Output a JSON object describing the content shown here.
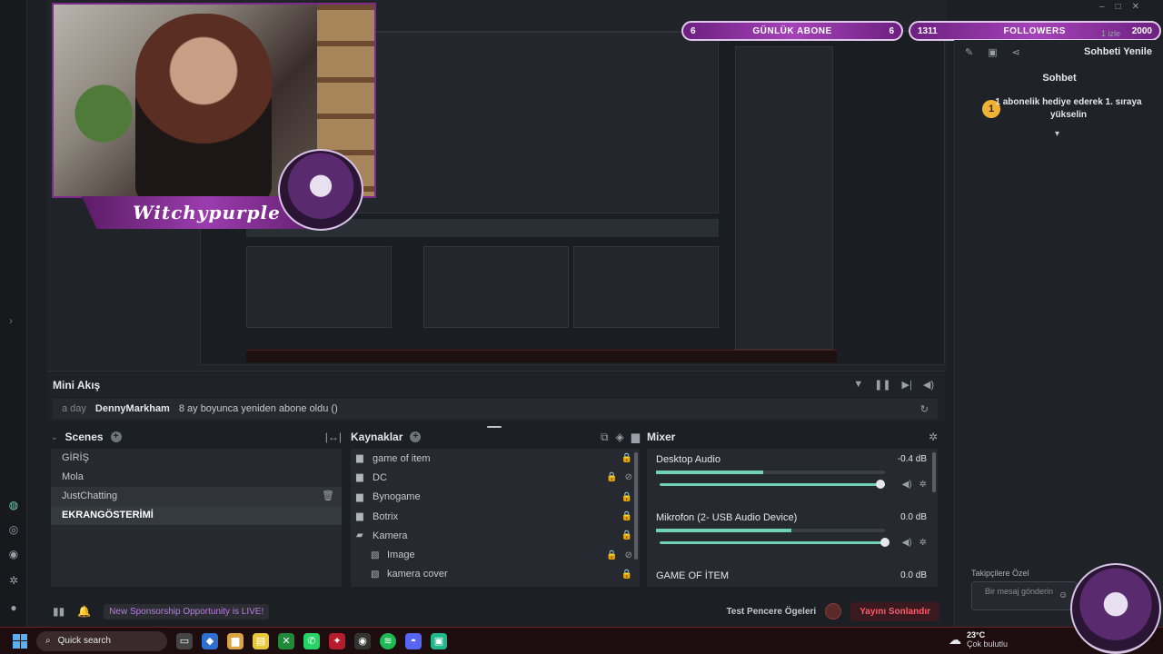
{
  "overlay": {
    "streamer_name": "Witchypurple",
    "daily_subs": {
      "label": "GÜNLÜK ABONE",
      "current": "6",
      "goal": "6"
    },
    "followers": {
      "label": "FOLLOWERS",
      "current": "1311",
      "goal": "2000"
    },
    "viewers": "1 izle"
  },
  "chat": {
    "toolbar_refresh": "Sohbeti Yenile",
    "title": "Sohbet",
    "event_rank": "1",
    "event_text": "1 abonelik hediye ederek 1. sıraya yükselin",
    "follower_only": "Takipçilere Özel",
    "message_placeholder": "Bir mesaj gönderin"
  },
  "mini_feed": {
    "title": "Mini Akış",
    "item": {
      "time": "a day",
      "user": "DennyMarkham",
      "text": "8 ay boyunca yeniden abone oldu ()"
    }
  },
  "scenes": {
    "title": "Scenes",
    "items": [
      "GİRİŞ",
      "Mola",
      "JustChatting",
      "EKRANGÖSTERİMİ"
    ],
    "hover_index": 2,
    "active_index": 3
  },
  "sources": {
    "title": "Kaynaklar",
    "items": [
      {
        "label": "game of item",
        "type": "folder",
        "child": false
      },
      {
        "label": "DC",
        "type": "folder",
        "child": false
      },
      {
        "label": "Bynogame",
        "type": "folder",
        "child": false
      },
      {
        "label": "Botrix",
        "type": "folder",
        "child": false
      },
      {
        "label": "Kamera",
        "type": "folder-open",
        "child": false
      },
      {
        "label": "Image",
        "type": "image",
        "child": true
      },
      {
        "label": "kamera cover",
        "type": "image",
        "child": true
      }
    ]
  },
  "mixer": {
    "title": "Mixer",
    "tracks": [
      {
        "name": "Desktop Audio",
        "db": "-0.4 dB",
        "level": 0.47,
        "volume": 0.98
      },
      {
        "name": "Mikrofon (2- USB Audio Device)",
        "db": "0.0 dB",
        "level": 0.59,
        "volume": 1.0
      },
      {
        "name": "GAME OF İTEM",
        "db": "0.0 dB",
        "level": 0,
        "volume": 1.0
      }
    ]
  },
  "status": {
    "news": "New Sponsorship Opportunity is LIVE!",
    "test_elements": "Test Pencere Ögeleri",
    "end_stream": "Yayını Sonlandır"
  },
  "taskbar": {
    "search_placeholder": "Quick search",
    "temperature": "23°C",
    "condition": "Çok bulutlu"
  },
  "colors": {
    "accent": "#a442b8",
    "mixer_green": "#6fd0b3",
    "end_red": "#ff5a6a"
  }
}
